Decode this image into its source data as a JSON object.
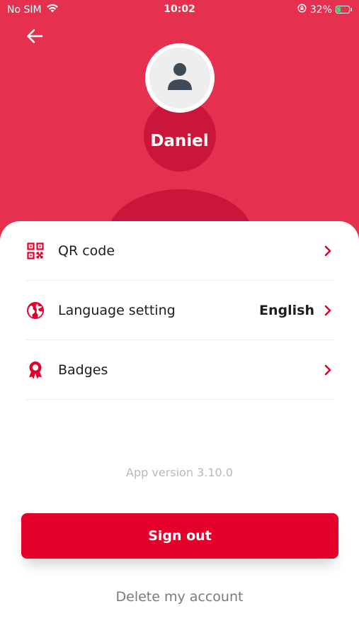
{
  "status_bar": {
    "carrier": "No SIM",
    "time": "10:02",
    "battery_percent": "32%",
    "battery_level": 0.32,
    "icons": [
      "wifi-icon",
      "orientation-lock-icon",
      "battery-charging-icon"
    ]
  },
  "header": {
    "back_icon": "arrow-left-icon",
    "avatar_icon": "person-icon",
    "user_name": "Daniel"
  },
  "menu": {
    "items": [
      {
        "icon": "qr-code-icon",
        "label": "QR code",
        "value": ""
      },
      {
        "icon": "globe-icon",
        "label": "Language setting",
        "value": "English"
      },
      {
        "icon": "badge-ribbon-icon",
        "label": "Badges",
        "value": ""
      }
    ]
  },
  "footer": {
    "app_version": "App version 3.10.0",
    "sign_out_label": "Sign out",
    "delete_account_label": "Delete my account"
  },
  "colors": {
    "header_bg": "#e5304f",
    "header_shape": "#c9163a",
    "accent": "#e4002b",
    "text_primary": "#1d1d1d",
    "text_muted": "#b9b9b9"
  }
}
